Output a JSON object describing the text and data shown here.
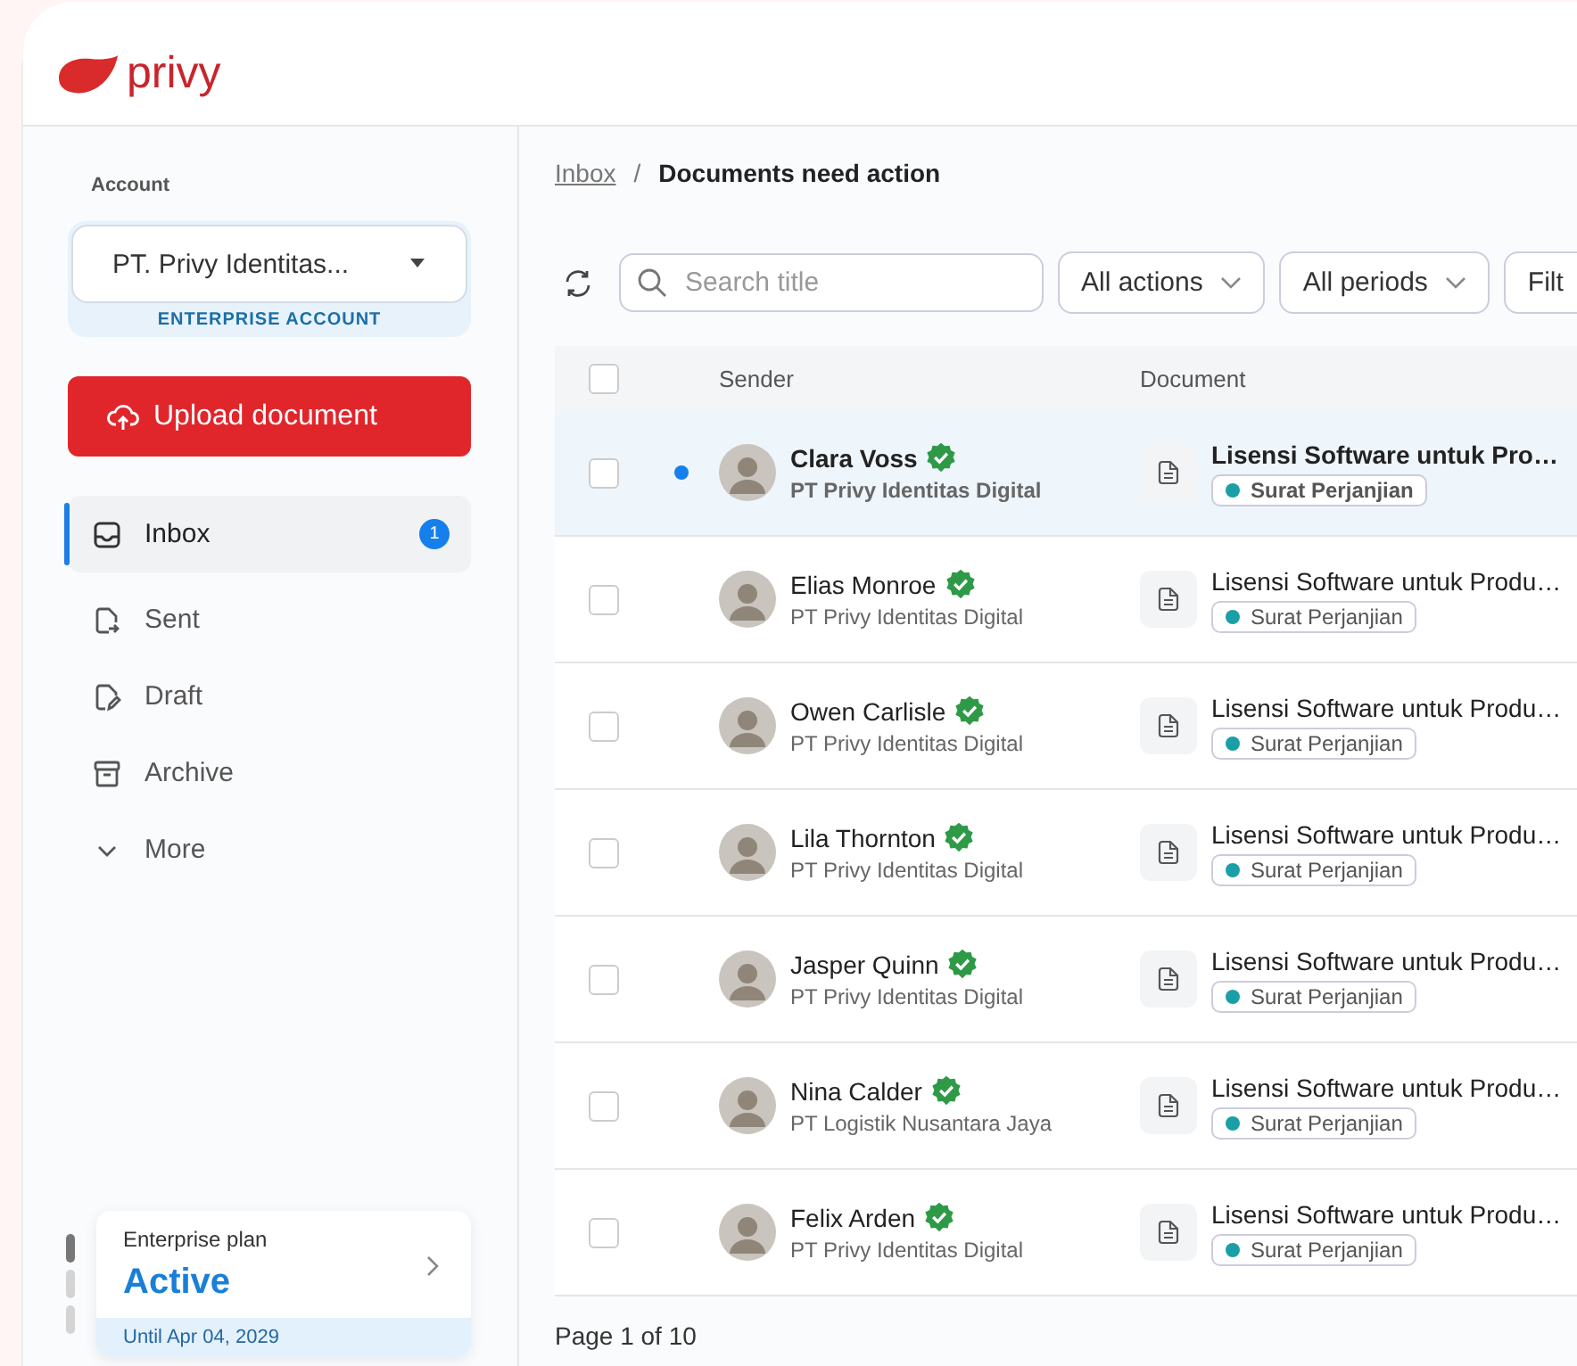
{
  "logo": {
    "text": "privy"
  },
  "sidebar": {
    "account_label": "Account",
    "account": {
      "value": "PT. Privy Identitas...",
      "type_label": "ENTERPRISE ACCOUNT"
    },
    "upload_button": "Upload document",
    "items": [
      {
        "label": "Inbox",
        "kind": "inbox",
        "selected": true,
        "badge": "1"
      },
      {
        "label": "Sent",
        "kind": "sent",
        "selected": false
      },
      {
        "label": "Draft",
        "kind": "draft",
        "selected": false
      },
      {
        "label": "Archive",
        "kind": "archive",
        "selected": false
      },
      {
        "label": "More",
        "kind": "more",
        "selected": false
      }
    ],
    "plan": {
      "title": "Enterprise plan",
      "status": "Active",
      "until": "Until Apr 04, 2029"
    }
  },
  "breadcrumb": {
    "parent": "Inbox",
    "separator": "/",
    "current": "Documents need action"
  },
  "toolbar": {
    "search": {
      "placeholder": "Search title"
    },
    "filters": [
      "All actions",
      "All periods"
    ],
    "cut_filter": "Filt"
  },
  "table": {
    "columns": [
      "Sender",
      "Document"
    ],
    "header_checked": false,
    "rows": [
      {
        "unread": true,
        "checked": false,
        "name": "Clara Voss",
        "company": "PT Privy Identitas Digital",
        "document": "Lisensi Software untuk Pro…",
        "tag": "Surat Perjanjian",
        "color": "#1a9fa6"
      },
      {
        "unread": false,
        "checked": false,
        "name": "Elias Monroe",
        "company": "PT Privy Identitas Digital",
        "document": "Lisensi Software untuk Produ…",
        "tag": "Surat Perjanjian",
        "color": "#1a9fa6"
      },
      {
        "unread": false,
        "checked": false,
        "name": "Owen Carlisle",
        "company": "PT Privy Identitas Digital",
        "document": "Lisensi Software untuk Produ…",
        "tag": "Surat Perjanjian",
        "color": "#1a9fa6"
      },
      {
        "unread": false,
        "checked": false,
        "name": "Lila Thornton",
        "company": "PT Privy Identitas Digital",
        "document": "Lisensi Software untuk Produ…",
        "tag": "Surat Perjanjian",
        "color": "#1a9fa6"
      },
      {
        "unread": false,
        "checked": false,
        "name": "Jasper Quinn",
        "company": "PT Privy Identitas Digital",
        "document": "Lisensi Software untuk Produ…",
        "tag": "Surat Perjanjian",
        "color": "#1a9fa6"
      },
      {
        "unread": false,
        "checked": false,
        "name": "Nina Calder",
        "company": "PT Logistik Nusantara Jaya",
        "document": "Lisensi Software untuk Produ…",
        "tag": "Surat Perjanjian",
        "color": "#1a9fa6"
      },
      {
        "unread": false,
        "checked": false,
        "name": "Felix Arden",
        "company": "PT Privy Identitas Digital",
        "document": "Lisensi Software untuk Produ…",
        "tag": "Surat Perjanjian",
        "color": "#1a9fa6"
      }
    ]
  },
  "pagination": {
    "text": "Page 1 of 10"
  }
}
